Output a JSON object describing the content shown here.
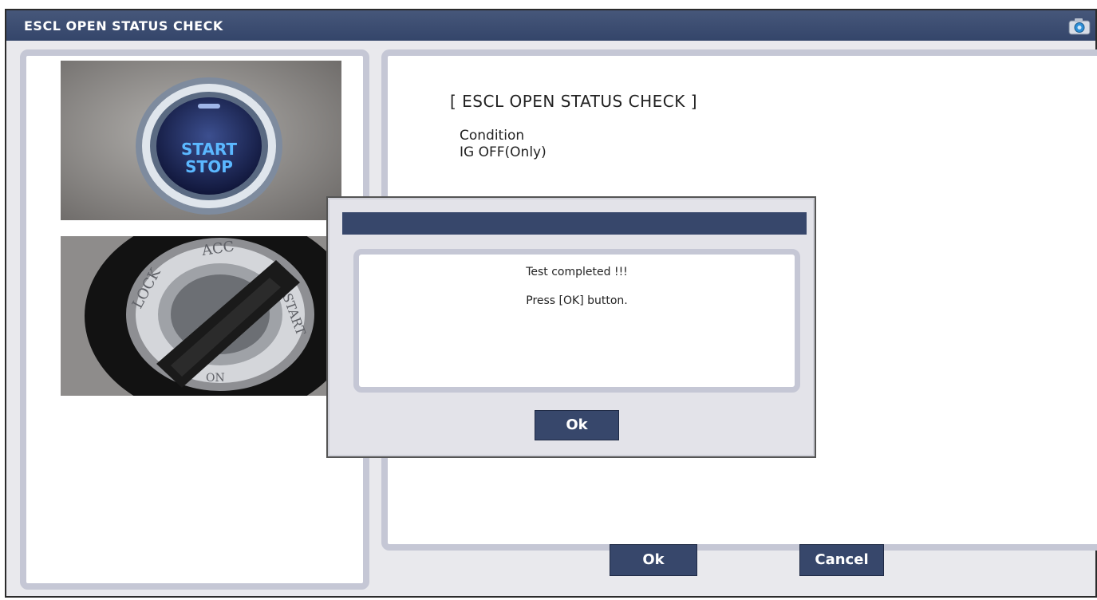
{
  "window": {
    "title": "ESCL OPEN STATUS CHECK",
    "camera_icon": "camera-icon"
  },
  "left_panel": {
    "images": [
      {
        "name": "start-stop-button-photo",
        "text": [
          "START",
          "STOP"
        ]
      },
      {
        "name": "ignition-key-photo",
        "text": [
          "LOCK",
          "ACC",
          "START",
          "ON"
        ]
      }
    ]
  },
  "right_panel": {
    "heading": "[ ESCL OPEN STATUS CHECK ]",
    "condition_label": "Condition",
    "condition_value": "IG OFF(Only)"
  },
  "buttons": {
    "ok": "Ok",
    "cancel": "Cancel"
  },
  "dialog": {
    "message_line1": "Test completed !!!",
    "message_line2": "Press [OK] button.",
    "ok_label": "Ok"
  },
  "colors": {
    "titlebar": "#37476b",
    "panel_border": "#c5c7d5",
    "button": "#37476b",
    "window_bg": "#e9e9ed"
  }
}
